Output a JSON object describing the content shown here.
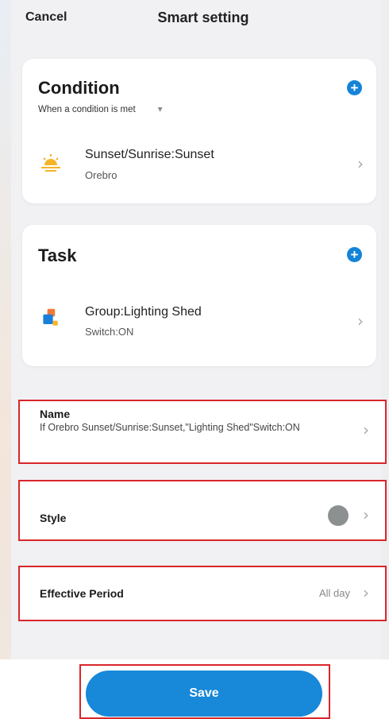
{
  "header": {
    "cancel_label": "Cancel",
    "title": "Smart setting"
  },
  "condition": {
    "heading": "Condition",
    "subheading": "When a condition is met",
    "add_icon": "plus-circle-icon",
    "items": [
      {
        "icon": "sunset-icon",
        "title": "Sunset/Sunrise:Sunset",
        "subtitle": "Orebro"
      }
    ]
  },
  "task": {
    "heading": "Task",
    "add_icon": "plus-circle-icon",
    "items": [
      {
        "icon": "group-icon",
        "title": "Group:Lighting Shed",
        "subtitle": "Switch:ON"
      }
    ]
  },
  "settings": {
    "name_label": "Name",
    "name_value": "If Orebro Sunset/Sunrise:Sunset,\"Lighting Shed\"Switch:ON",
    "style_label": "Style",
    "style_color": "#8d9090",
    "period_label": "Effective Period",
    "period_value": "All day"
  },
  "footer": {
    "save_label": "Save"
  },
  "colors": {
    "accent": "#1888d8",
    "highlight": "#d9262b"
  }
}
